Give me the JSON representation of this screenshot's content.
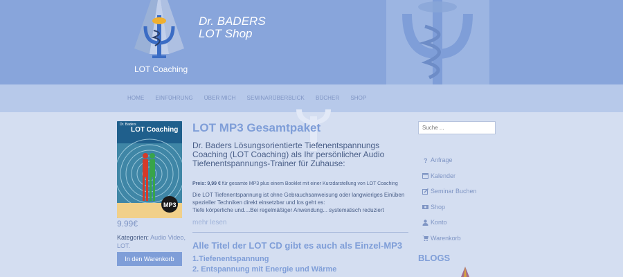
{
  "header": {
    "title_line1": "Dr. BADERS",
    "title_line2": "LOT Shop",
    "logo_label": "LOT Coaching"
  },
  "nav": {
    "items": [
      "HOME",
      "EINFÜHRUNG",
      "ÜBER MICH",
      "SEMINARÜBERBLICK",
      "BÜCHER",
      "SHOP"
    ]
  },
  "product": {
    "cover_title_small": "Dr. Baders",
    "cover_title": "LOT Coaching",
    "cover_badge": "MP3",
    "price": "9.99€",
    "categories_label": "Kategorien:",
    "categories": "Audio Video, LOT.",
    "add_to_cart": "In den Warenkorb"
  },
  "main": {
    "title": "LOT MP3 Gesamtpaket",
    "subtitle": "Dr. Baders Lösungsorientierte Tiefenentspannungs Coaching (LOT Coaching) als Ihr persönlicher Audio Tiefenentspannungs-Trainer für Zuhause:",
    "price_label": "Preis: 9,99 €",
    "price_desc": " für gesamte MP3 plus einem Booklet mit einer Kurzdarstellung von LOT Coaching",
    "desc1": "Die LOT Tiefenentspannung ist ohne Gebrauchsanweisung oder langwieriges Einüben spezieller Techniken direkt einsetzbar und los geht es:",
    "desc2": "Tiefe körperliche und....Bei regelmäßiger Anwendung... systematisch reduziert",
    "more": "mehr lesen",
    "section_title": "Alle Titel der LOT CD gibt es auch als Einzel-MP3",
    "track1": "1.Tiefenentspannung",
    "track2": "2. Entspannung mit Energie und Wärme"
  },
  "sidebar": {
    "search_placeholder": "Suche ...",
    "links": [
      {
        "label": "Anfrage",
        "icon": "question-icon"
      },
      {
        "label": "Kalender",
        "icon": "calendar-icon"
      },
      {
        "label": "Seminar Buchen",
        "icon": "edit-icon"
      },
      {
        "label": "Shop",
        "icon": "shop-icon"
      },
      {
        "label": "Konto",
        "icon": "user-icon"
      },
      {
        "label": "Warenkorb",
        "icon": "cart-icon"
      }
    ],
    "blogs_heading": "BLOGS"
  },
  "colors": {
    "header_bg": "#88a5db",
    "nav_bg": "#b7c9ea",
    "page_bg": "#d4def1",
    "accent": "#7f9ed8"
  }
}
